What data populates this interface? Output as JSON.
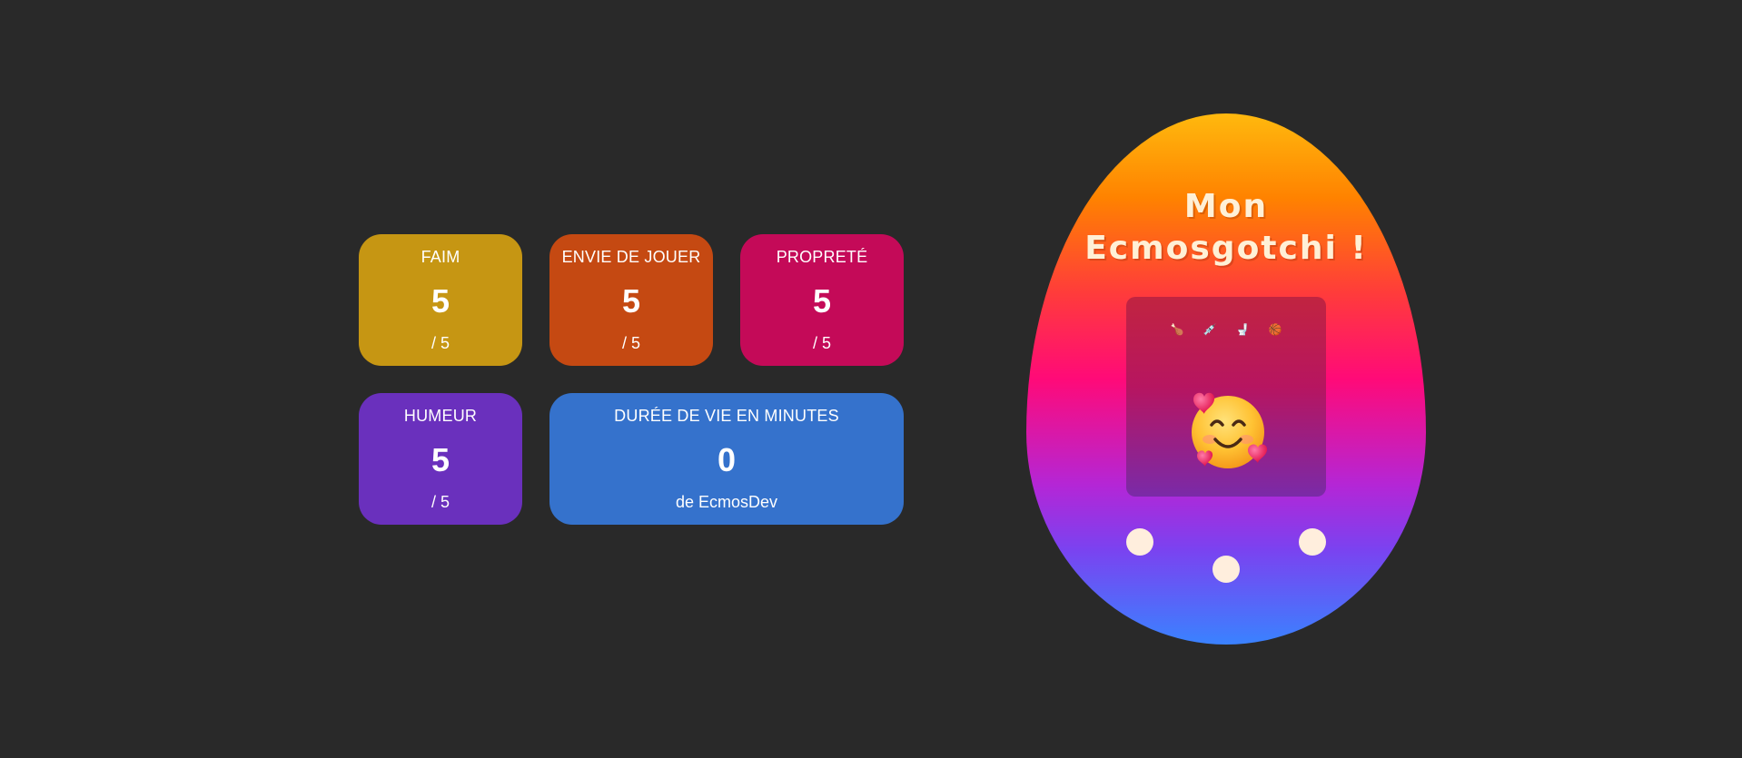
{
  "stats": {
    "faim": {
      "label": "FAIM",
      "value": "5",
      "suffix": "/ 5"
    },
    "jouer": {
      "label": "ENVIE DE JOUER",
      "value": "5",
      "suffix": "/ 5"
    },
    "proprete": {
      "label": "PROPRETÉ",
      "value": "5",
      "suffix": "/ 5"
    },
    "humeur": {
      "label": "HUMEUR",
      "value": "5",
      "suffix": "/ 5"
    },
    "duree": {
      "label": "DURÉE DE VIE EN MINUTES",
      "value": "0",
      "suffix": "de EcmosDev"
    }
  },
  "egg": {
    "title_line1": "Mon",
    "title_line2": "Ecmosgotchi !",
    "toolbar": [
      {
        "icon": "drumstick-icon",
        "glyph": "🍗"
      },
      {
        "icon": "syringe-icon",
        "glyph": "💉"
      },
      {
        "icon": "toilet-icon",
        "glyph": "🚽"
      },
      {
        "icon": "ball-icon",
        "glyph": "🏀"
      }
    ],
    "pet_icon": "smiling-face-with-hearts-icon"
  },
  "colors": {
    "background": "#292929",
    "faim": "#c69613",
    "jouer": "#c54912",
    "proprete": "#c40a58",
    "humeur": "#6a30bd",
    "duree": "#3572cc",
    "button": "#ffeedd"
  }
}
